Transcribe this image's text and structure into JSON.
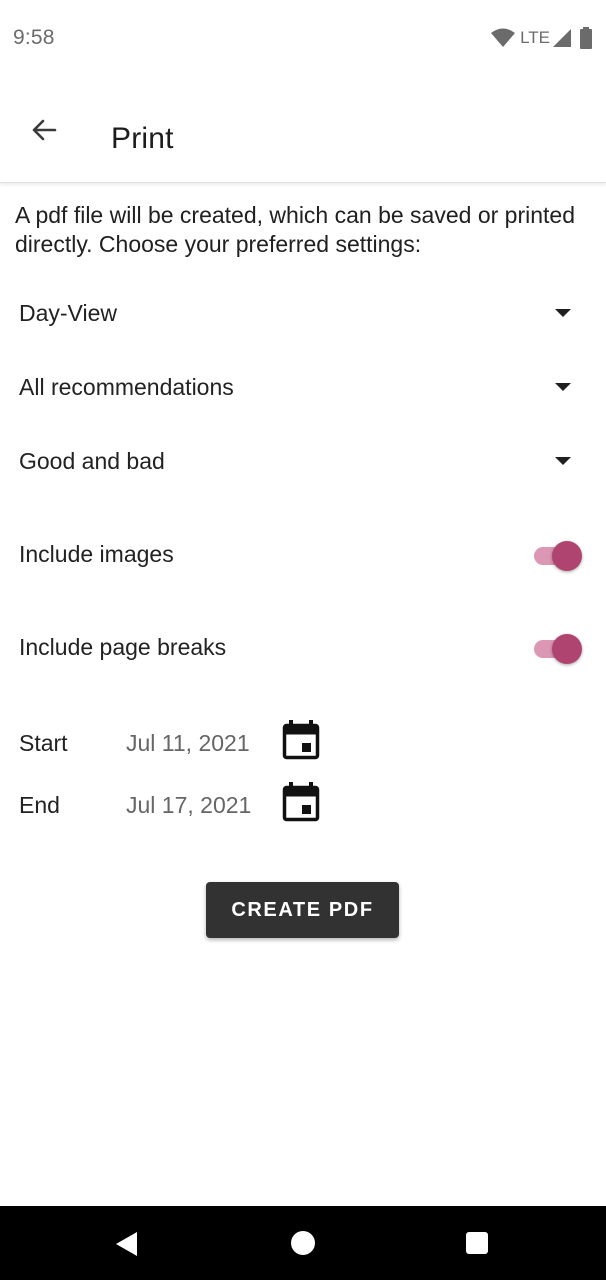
{
  "status_bar": {
    "time": "9:58",
    "network": "LTE",
    "icons": [
      "wifi-icon",
      "signal-icon",
      "battery-icon"
    ]
  },
  "app_bar": {
    "title": "Print",
    "back_icon": "arrow-back-icon"
  },
  "intro": {
    "text": "A pdf file will be created, which can be saved or printed directly. Choose your preferred settings:"
  },
  "dropdowns": [
    {
      "selected": "Day-View"
    },
    {
      "selected": "All recommendations"
    },
    {
      "selected": "Good and bad"
    }
  ],
  "toggles": [
    {
      "label": "Include images",
      "checked": true
    },
    {
      "label": "Include page breaks",
      "checked": true
    }
  ],
  "dates": [
    {
      "label": "Start",
      "value": "Jul 11, 2021",
      "icon": "calendar-icon"
    },
    {
      "label": "End",
      "value": "Jul 17, 2021",
      "icon": "calendar-icon"
    }
  ],
  "actions": {
    "create_pdf_label": "CREATE PDF"
  },
  "nav_bar": {
    "icons": [
      "nav-back-icon",
      "nav-home-icon",
      "nav-recents-icon"
    ]
  },
  "colors": {
    "accent": "#b04470",
    "accent_track": "#dc97b4",
    "button_bg": "#323232",
    "nav_bar_bg": "#000000"
  }
}
